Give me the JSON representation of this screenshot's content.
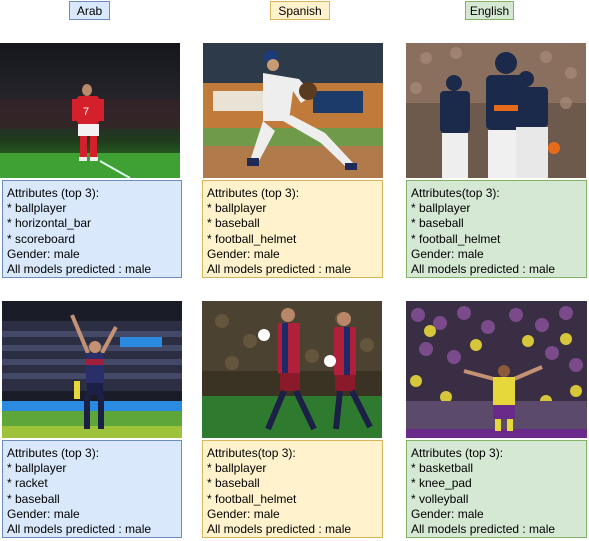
{
  "headers": {
    "col1": "Arab",
    "col2": "Spanish",
    "col3": "English"
  },
  "cells": {
    "r1c1": {
      "attr_title": "Attributes (top 3):",
      "attrs": [
        "* ballplayer",
        "* horizontal_bar",
        "* scoreboard"
      ],
      "gender": "Gender: male",
      "models": "All models predicted : male"
    },
    "r1c2": {
      "attr_title": "Attributes (top 3):",
      "attrs": [
        "* ballplayer",
        "* baseball",
        "* football_helmet"
      ],
      "gender": "Gender: male",
      "models": "All models predicted : male"
    },
    "r1c3": {
      "attr_title": "Attributes(top 3):",
      "attrs": [
        "* ballplayer",
        "* baseball",
        "* football_helmet"
      ],
      "gender": "Gender: male",
      "models": "All models predicted : male"
    },
    "r2c1": {
      "attr_title": "Attributes (top 3):",
      "attrs": [
        "* ballplayer",
        "* racket",
        "* baseball"
      ],
      "gender": "Gender: male",
      "models": "All models predicted : male"
    },
    "r2c2": {
      "attr_title": "Attributes(top 3):",
      "attrs": [
        "* ballplayer",
        "* baseball",
        "* football_helmet"
      ],
      "gender": "Gender: male",
      "models": "All models predicted : male"
    },
    "r2c3": {
      "attr_title": "Attributes (top 3):",
      "attrs": [
        "* basketball",
        "* knee_pad",
        "* volleyball"
      ],
      "gender": "Gender: male",
      "models": "All models predicted : male"
    }
  },
  "colors": {
    "blue_fill": "#dae8fc",
    "blue_border": "#6c8ebf",
    "yellow_fill": "#fff2cc",
    "yellow_border": "#d6b656",
    "green_fill": "#d5e8d4",
    "green_border": "#82b366"
  }
}
